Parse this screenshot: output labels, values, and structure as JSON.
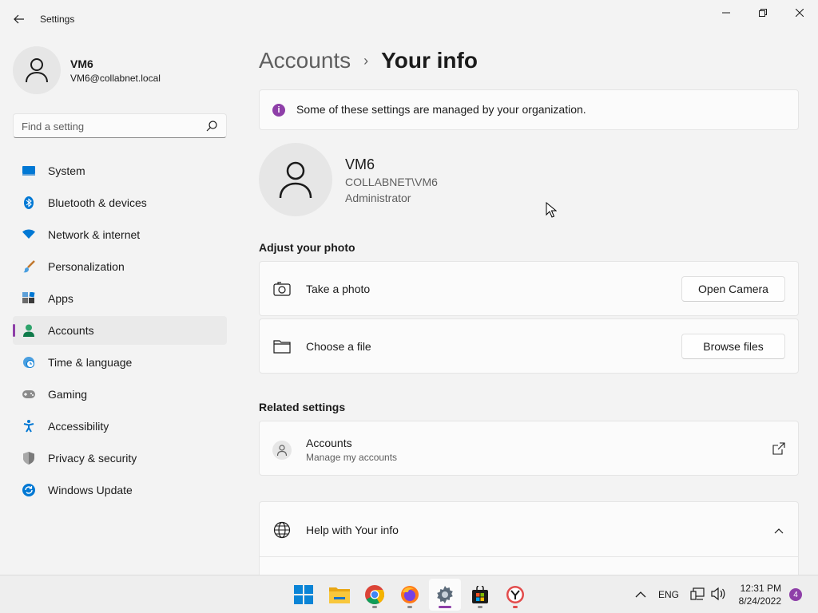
{
  "window": {
    "title": "Settings"
  },
  "profile": {
    "name": "VM6",
    "email": "VM6@collabnet.local"
  },
  "search": {
    "placeholder": "Find a setting"
  },
  "sidebar": {
    "items": [
      {
        "label": "System",
        "icon": "system-icon",
        "active": false
      },
      {
        "label": "Bluetooth & devices",
        "icon": "bluetooth-icon",
        "active": false
      },
      {
        "label": "Network & internet",
        "icon": "wifi-icon",
        "active": false
      },
      {
        "label": "Personalization",
        "icon": "brush-icon",
        "active": false
      },
      {
        "label": "Apps",
        "icon": "apps-icon",
        "active": false
      },
      {
        "label": "Accounts",
        "icon": "accounts-icon",
        "active": true
      },
      {
        "label": "Time & language",
        "icon": "globe-clock-icon",
        "active": false
      },
      {
        "label": "Gaming",
        "icon": "gamepad-icon",
        "active": false
      },
      {
        "label": "Accessibility",
        "icon": "accessibility-icon",
        "active": false
      },
      {
        "label": "Privacy & security",
        "icon": "shield-icon",
        "active": false
      },
      {
        "label": "Windows Update",
        "icon": "update-icon",
        "active": false
      }
    ]
  },
  "breadcrumb": {
    "parent": "Accounts",
    "separator": "›",
    "current": "Your info"
  },
  "banner": {
    "text": "Some of these settings are managed by your organization.",
    "icon_glyph": "i"
  },
  "user": {
    "name": "VM6",
    "domain_account": "COLLABNET\\VM6",
    "role": "Administrator"
  },
  "adjust_photo": {
    "title": "Adjust your photo",
    "rows": [
      {
        "label": "Take a photo",
        "button": "Open Camera",
        "icon": "camera-icon"
      },
      {
        "label": "Choose a file",
        "button": "Browse files",
        "icon": "folder-icon"
      }
    ]
  },
  "related": {
    "title": "Related settings",
    "accounts_title": "Accounts",
    "accounts_subtitle": "Manage my accounts"
  },
  "help": {
    "label": "Help with Your info"
  },
  "taskbar": {
    "apps": [
      "start-icon",
      "file-explorer-icon",
      "chrome-icon",
      "firefox-icon",
      "settings-icon",
      "store-icon",
      "app-icon"
    ],
    "lang": "ENG",
    "time": "12:31 PM",
    "date": "8/24/2022",
    "notification_count": "4"
  },
  "colors": {
    "accent": "#8e3fa8",
    "background": "#f3f3f3",
    "card": "#fbfbfb"
  }
}
